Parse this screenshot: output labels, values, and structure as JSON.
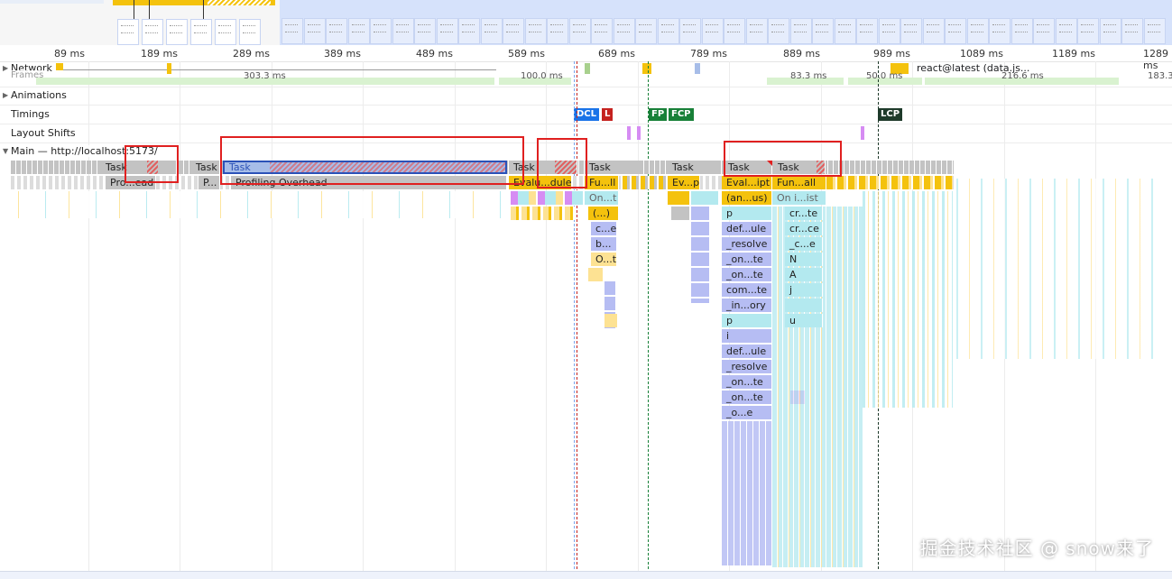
{
  "ruler": {
    "ticks": [
      "89 ms",
      "189 ms",
      "289 ms",
      "389 ms",
      "489 ms",
      "589 ms",
      "689 ms",
      "789 ms",
      "889 ms",
      "989 ms",
      "1089 ms",
      "1189 ms",
      "1289 ms"
    ]
  },
  "tracks": {
    "network_label": "Network",
    "network_item": "react@latest (data.js...",
    "frames_label": "Frames",
    "frames_values": [
      "303.3 ms",
      "100.0 ms",
      "83.3 ms",
      "50.0 ms",
      "216.6 ms",
      "183.3"
    ],
    "animations_label": "Animations",
    "timings_label": "Timings",
    "layout_shifts_label": "Layout Shifts",
    "main_label": "Main — http://localhost:5173/"
  },
  "markers": {
    "dcl": "DCL",
    "l": "L",
    "fp": "FP",
    "fcp": "FCP",
    "lcp": "LCP"
  },
  "flame": {
    "task": "Task",
    "profiling_overhead": "Profiling Overhead",
    "pro_ead": "Pro...ead",
    "p_dot": "P...",
    "evalu_dule": "Evalu...dule",
    "fu_ll": "Fu...ll",
    "on_t": "On...t",
    "paren": "(...)",
    "c_e": "c...e",
    "b_dot": "b...",
    "o_t": "O...t",
    "ev_pt": "Ev...pt",
    "eval_ipt": "Eval...ipt",
    "fun_all": "Fun...all",
    "an_us": "(an...us)",
    "on_i_ist": "On i...ist",
    "col_left": [
      "p",
      "def...ule",
      "_resolve",
      "_on...te",
      "_on...te",
      "com...te",
      "_in...ory",
      "p",
      "i",
      "def...ule",
      "_resolve",
      "_on...te",
      "_on...te",
      "_o...e"
    ],
    "col_right": [
      "cr...te",
      "cr...ce",
      "_c...e",
      "N",
      "A",
      "j",
      "",
      "u"
    ]
  },
  "watermark": "掘金技术社区 @ snow来了",
  "colors": {
    "task_gray": "#c3c3c3",
    "task_selected": "#a7bde8",
    "script_yellow": "#f4c20d",
    "script_light": "#fde293",
    "lavender": "#b6bdf3",
    "cyan": "#b3e9ef",
    "purple": "#d68cf3",
    "dcl_blue": "#1a73e8",
    "l_red": "#c5221f",
    "fp_green": "#188038",
    "lcp_dark": "#1e3a2a",
    "annotation_red": "#e02020"
  }
}
